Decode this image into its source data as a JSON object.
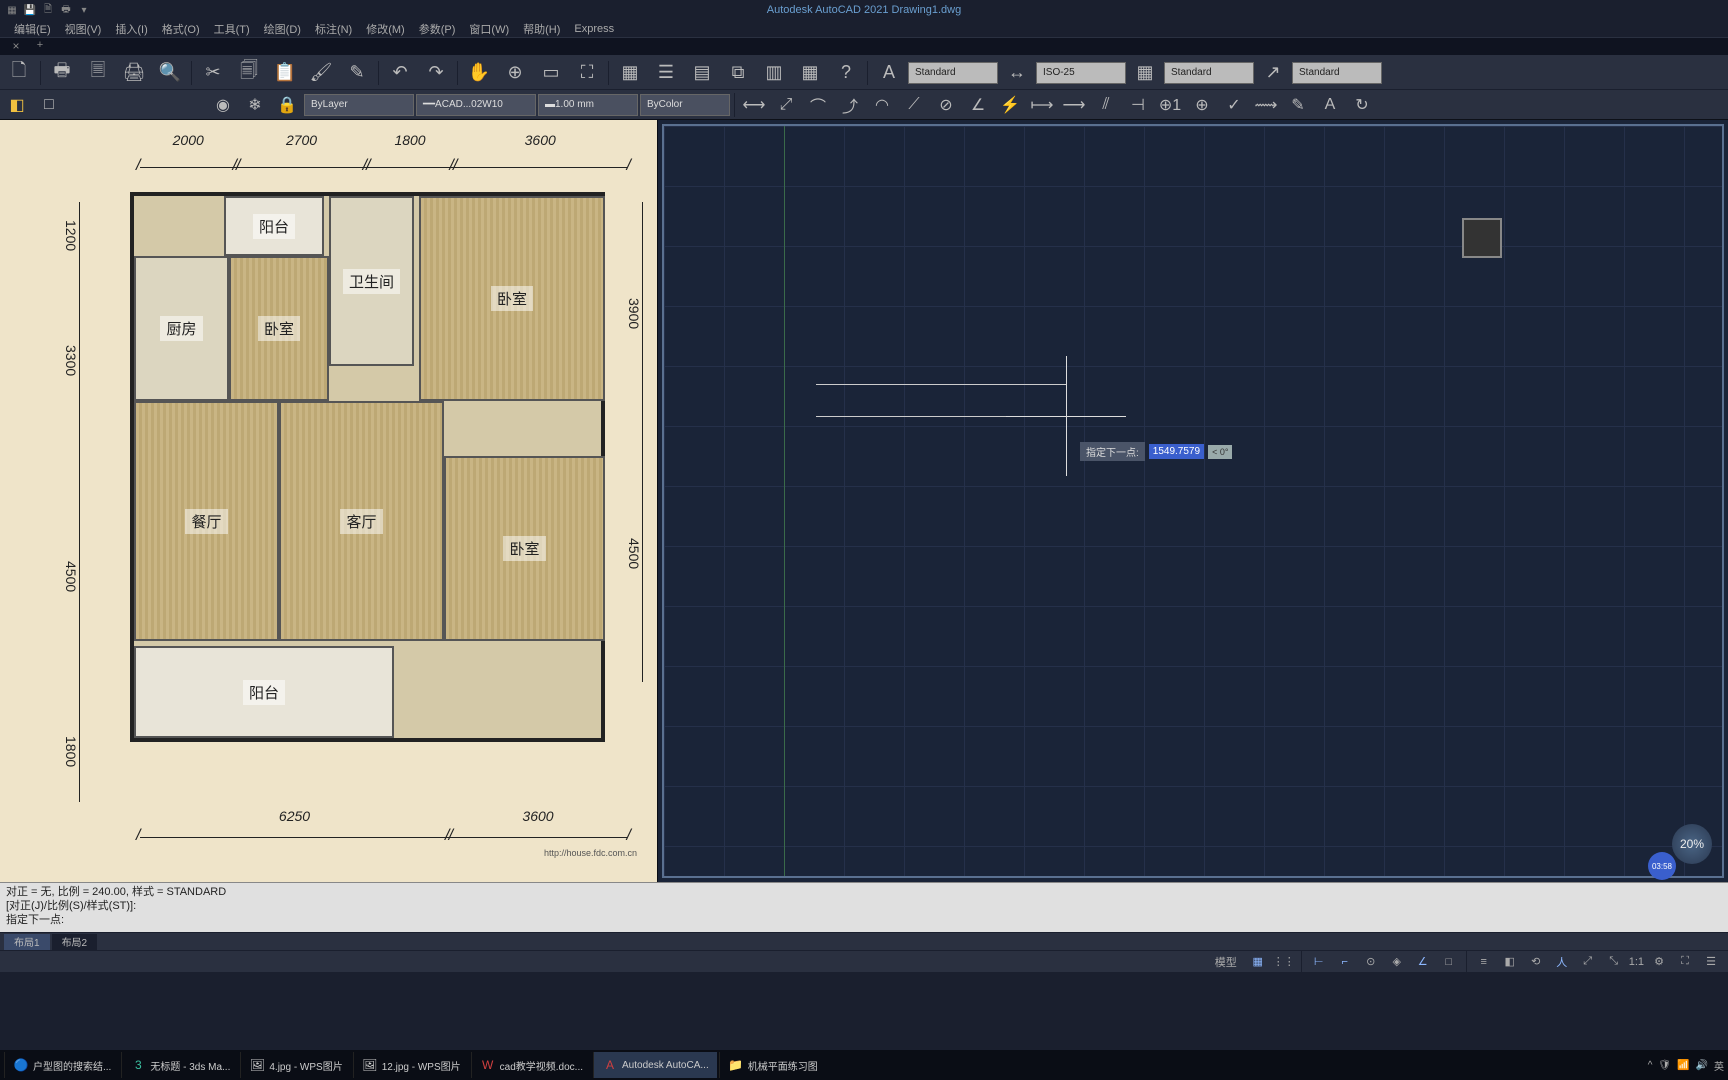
{
  "app": {
    "title": "Autodesk AutoCAD 2021    Drawing1.dwg"
  },
  "menu": [
    "编辑(E)",
    "视图(V)",
    "插入(I)",
    "格式(O)",
    "工具(T)",
    "绘图(D)",
    "标注(N)",
    "修改(M)",
    "参数(P)",
    "窗口(W)",
    "帮助(H)",
    "Express"
  ],
  "ribbon_dropdowns": {
    "text_style": "Standard",
    "dim_style": "ISO-25",
    "table_style": "Standard",
    "mleader_style": "Standard"
  },
  "props": {
    "layer": "ByLayer",
    "linetype": "ACAD...02W10",
    "lineweight": "1.00 mm",
    "color": "ByColor"
  },
  "floorplan": {
    "dims_top": [
      "2000",
      "2700",
      "1800",
      "3600"
    ],
    "dims_left": [
      "1200",
      "3300",
      "4500",
      "1800"
    ],
    "dims_right": [
      "3900",
      "4500"
    ],
    "dims_bottom": [
      "6250",
      "3600"
    ],
    "rooms": {
      "balcony1": "阳台",
      "bathroom": "卫生间",
      "kitchen": "厨房",
      "bedroom1": "卧室",
      "bedroom2": "卧室",
      "bedroom3": "卧室",
      "dining": "餐厅",
      "living": "客厅",
      "balcony2": "阳台"
    },
    "url": "http://house.fdc.com.cn"
  },
  "dynamic_input": {
    "prompt": "指定下一点:",
    "value": "1549.7579",
    "angle": "< 0°"
  },
  "zoom": "20%",
  "timer": "03:58",
  "cmdlog": [
    "对正 = 无, 比例 = 240.00, 样式 = STANDARD",
    "[对正(J)/比例(S)/样式(ST)]:",
    "指定下一点:"
  ],
  "layout_tabs": {
    "active": "布局1",
    "other": "布局2"
  },
  "status_model": "模型",
  "status_scale": "1:1",
  "taskbar": {
    "items": [
      "户型图的搜索结...",
      "无标题 - 3ds Ma...",
      "4.jpg - WPS图片",
      "12.jpg - WPS图片",
      "cad教学视频.doc...",
      "Autodesk AutoCA...",
      "机械平面练习图"
    ],
    "ime": "英"
  }
}
